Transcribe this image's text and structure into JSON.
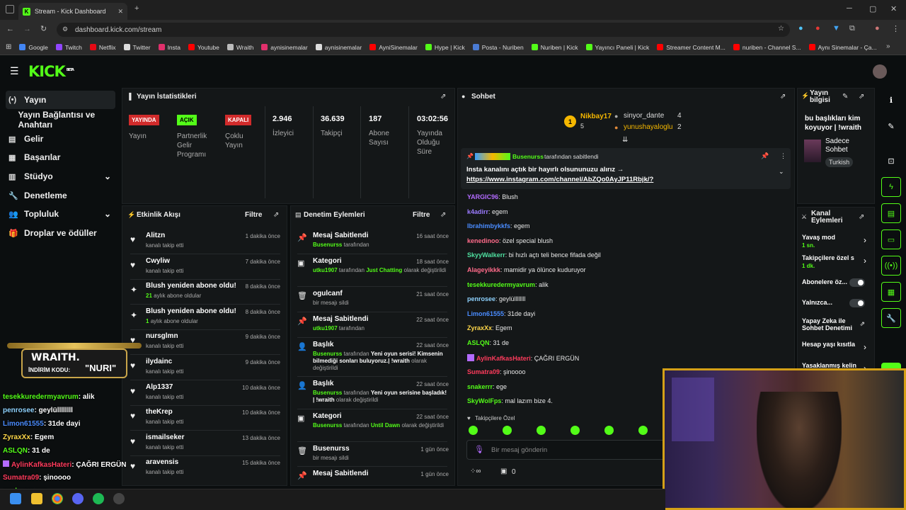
{
  "browser": {
    "tab_title": "Stream - Kick Dashboard",
    "new_tab": "+",
    "url": "dashboard.kick.com/stream",
    "bookmarks": [
      {
        "label": "Google",
        "color": "#4285f4"
      },
      {
        "label": "Twitch",
        "color": "#9146ff"
      },
      {
        "label": "Netflix",
        "color": "#e50914"
      },
      {
        "label": "Twitter",
        "color": "#dddddd"
      },
      {
        "label": "Insta",
        "color": "#e1306c"
      },
      {
        "label": "Youtube",
        "color": "#ff0000"
      },
      {
        "label": "Wraith",
        "color": "#bbbbbb"
      },
      {
        "label": "aynisinemalar",
        "color": "#e1306c"
      },
      {
        "label": "aynisinemalar",
        "color": "#dddddd"
      },
      {
        "label": "AyniSinemalar",
        "color": "#ff0000"
      },
      {
        "label": "Hype | Kick",
        "color": "#53fc18"
      },
      {
        "label": "Posta - Nuriben",
        "color": "#4a7bd4"
      },
      {
        "label": "Nuriben | Kick",
        "color": "#53fc18"
      },
      {
        "label": "Yayıncı Paneli | Kick",
        "color": "#53fc18"
      },
      {
        "label": "Streamer Content M...",
        "color": "#ff0000"
      },
      {
        "label": "nuriben - Channel S...",
        "color": "#ff0000"
      },
      {
        "label": "Aynı Sinemalar - Ça...",
        "color": "#ff0000"
      }
    ],
    "more": "»"
  },
  "app": {
    "logo": "KICK",
    "beta": "BETA"
  },
  "sidebar": [
    {
      "label": "Yayın",
      "icon": "(•)"
    },
    {
      "label": "Yayın Bağlantısı ve Anahtarı",
      "icon": ""
    },
    {
      "label": "Gelir",
      "icon": "▤"
    },
    {
      "label": "Başarılar",
      "icon": "▦"
    },
    {
      "label": "Stüdyo",
      "icon": "▥",
      "chevron": "⌄"
    },
    {
      "label": "Denetleme",
      "icon": "🔧"
    },
    {
      "label": "Topluluk",
      "icon": "👥",
      "chevron": "⌄"
    },
    {
      "label": "Droplar ve ödüller",
      "icon": "🎁"
    }
  ],
  "stats": {
    "title": "Yayın İstatistikleri",
    "live": {
      "badge": "YAYINDA",
      "label": "Yayın"
    },
    "partner": {
      "badge": "AÇIK",
      "label": "Partnerlik Gelir Programı"
    },
    "multi": {
      "badge": "KAPALI",
      "label": "Çoklu Yayın"
    },
    "viewers": {
      "value": "2.946",
      "label": "İzleyici"
    },
    "followers": {
      "value": "36.639",
      "label": "Takipçi"
    },
    "subs": {
      "value": "187",
      "label": "Abone Sayısı"
    },
    "duration": {
      "value": "03:02:56",
      "label": "Yayında Olduğu Süre"
    }
  },
  "activity": {
    "title": "Etkinlik Akışı",
    "filter": "Filtre",
    "items": [
      {
        "icon": "♥",
        "name": "Alitzn",
        "sub": "kanalı takip etti",
        "time": "1 dakika önce"
      },
      {
        "icon": "♥",
        "name": "Cwyliw",
        "sub": "kanalı takip etti",
        "time": "7 dakika önce"
      },
      {
        "icon": "✦",
        "name": "Blush yeniden abone oldu!",
        "subnum": "21",
        "sub": "aylık abone oldular",
        "time": "8 dakika önce"
      },
      {
        "icon": "✦",
        "name": "Blush yeniden abone oldu!",
        "subnum": "1",
        "sub": "aylık abone oldular",
        "time": "8 dakika önce"
      },
      {
        "icon": "♥",
        "name": "nursglmn",
        "sub": "kanalı takip etti",
        "time": "9 dakika önce"
      },
      {
        "icon": "♥",
        "name": "ilydainc",
        "sub": "kanalı takip etti",
        "time": "9 dakika önce"
      },
      {
        "icon": "♥",
        "name": "Alp1337",
        "sub": "kanalı takip etti",
        "time": "10 dakika önce"
      },
      {
        "icon": "♥",
        "name": "theKrep",
        "sub": "kanalı takip etti",
        "time": "10 dakika önce"
      },
      {
        "icon": "♥",
        "name": "ismailseker",
        "sub": "kanalı takip etti",
        "time": "13 dakika önce"
      },
      {
        "icon": "♥",
        "name": "aravensis",
        "sub": "kanalı takip etti",
        "time": "15 dakika önce"
      }
    ]
  },
  "moderation": {
    "title": "Denetim Eylemleri",
    "filter": "Filtre",
    "items": [
      {
        "icon": "📌",
        "title": "Mesaj Sabitlendi",
        "time": "16 saat önce",
        "user": "Busenurss",
        "rest": "tarafından"
      },
      {
        "icon": "▣",
        "title": "Kategori",
        "time": "18 saat önce",
        "user": "utku1907",
        "mid": "tarafından",
        "green2": "Just Chatting",
        "rest": "olarak değiştirildi"
      },
      {
        "icon": "🗑",
        "title": "ogulcanf",
        "time": "21 saat önce",
        "rest": "bir mesajı sildi"
      },
      {
        "icon": "📌",
        "title": "Mesaj Sabitlendi",
        "time": "22 saat önce",
        "user": "utku1907",
        "rest": "tarafından"
      },
      {
        "icon": "👤",
        "title": "Başlık",
        "time": "22 saat önce",
        "user": "Busenurss",
        "mid": "tarafından",
        "white": "Yeni oyun serisi! Kimsenin bilmediği sonları buluyoruz.| !wraith",
        "rest": "olarak değiştirildi"
      },
      {
        "icon": "👤",
        "title": "Başlık",
        "time": "22 saat önce",
        "user": "Busenurss",
        "mid": "tarafından",
        "white": "Yeni oyun serisine başladık! | !wraith",
        "rest": "olarak değiştirildi"
      },
      {
        "icon": "▣",
        "title": "Kategori",
        "time": "22 saat önce",
        "user": "Busenurss",
        "mid": "tarafından",
        "green2": "Until Dawn",
        "rest": "olarak değiştirildi"
      },
      {
        "icon": "🗑",
        "title": "Busenurss",
        "time": "1 gün önce",
        "rest": "bir mesajı sildi"
      },
      {
        "icon": "📌",
        "title": "Mesaj Sabitlendi",
        "time": "1 gün önce"
      }
    ]
  },
  "chat": {
    "title": "Sohbet",
    "top": {
      "rank": "1",
      "user1": "Nikbay17",
      "count1": "5",
      "user2": "sinyor_dante",
      "count2": "4",
      "user3": "yunushayaloglu",
      "count3": "2"
    },
    "pinned": {
      "by": "Busenurss",
      "by_suffix": "tarafından sabitlendi",
      "text": "Insta kanalını açtık bir hayırlı olsununuzu alırız →",
      "link": "https://www.instagram.com/channel/AbZQo0AyJP11Rbjk/?"
    },
    "messages": [
      {
        "user": "YARGIC96",
        "color": "#b36bff",
        "text": ": Blush"
      },
      {
        "user": "k4adirr",
        "color": "#9b7bff",
        "text": ": egem"
      },
      {
        "user": "Ibrahimbykkfs",
        "color": "#4a8cff",
        "text": ": egem"
      },
      {
        "user": "kenedinoo",
        "color": "#ff6b8a",
        "text": ": özel special blush"
      },
      {
        "user": "SkyyWalkerr",
        "color": "#4fe0a0",
        "text": ": bi hızlı açtı teli bence fifada değil"
      },
      {
        "user": "Alageyikkk",
        "color": "#ff6b8a",
        "text": ": mamidir ya ölünce kuduruyor"
      },
      {
        "user": "tesekkuredermyavrum",
        "color": "#53fc18",
        "text": ": alik"
      },
      {
        "user": "penrosee",
        "color": "#8fd3ff",
        "text": ": geylüllllllll"
      },
      {
        "user": "Limon61555",
        "color": "#4a8cff",
        "text": ": 31de dayi"
      },
      {
        "user": "ZyraxXx",
        "color": "#ffd84a",
        "text": ": Egem"
      },
      {
        "user": "ASLQN",
        "color": "#53fc18",
        "text": ": 31 de"
      },
      {
        "user": "AylinKafkasHateri",
        "color": "#ff3b5c",
        "text": ": ÇAĞRI ERGÜN",
        "badge": "#b36bff"
      },
      {
        "user": "Sumatra09",
        "color": "#ff3b5c",
        "text": ": şinoooo"
      },
      {
        "user": "snakerrr",
        "color": "#53fc18",
        "text": ": ege"
      },
      {
        "user": "SkyWolFps",
        "color": "#53fc18",
        "text": ": mal lazım bize 4."
      }
    ],
    "followers_only": "Takipçilere Özel",
    "placeholder": "Bir mesaj gönderin",
    "viewer_count": "0"
  },
  "info": {
    "title": "Yayın bilgisi",
    "text": "bu başlıkları kim koyuyor | !wraith",
    "mode": "Sadece Sohbet",
    "lang": "Turkish"
  },
  "channel": {
    "title": "Kanal Eylemleri",
    "items": [
      {
        "label": "Yavaş mod",
        "sub": "1 sn.",
        "type": "chevron"
      },
      {
        "label": "Takipçilere özel s",
        "sub": "1 dk.",
        "type": "chevron"
      },
      {
        "label": "Abonelere öz...",
        "type": "toggle"
      },
      {
        "label": "Yalnızca...",
        "type": "toggle"
      },
      {
        "label": "Yapay Zeka ile Sohbet Denetimi",
        "type": "link"
      },
      {
        "label": "Hesap yaşı kısıtla",
        "type": "chevron"
      },
      {
        "label": "Yasaklanmış kelin",
        "type": "chevron"
      }
    ]
  },
  "overlay": {
    "brand": "WRAITH.",
    "code_label": "İNDİRİM KODU:",
    "code": "\"NURI\"",
    "lines": [
      {
        "user": "tesekkuredermyavrum",
        "text": ": alik",
        "color": "#53fc18"
      },
      {
        "user": "penrosee",
        "text": ": geylüllllllll",
        "color": "#8fd3ff"
      },
      {
        "user": "Limon61555",
        "text": ": 31de dayi",
        "color": "#4a8cff"
      },
      {
        "user": "ZyraxXx",
        "text": ": Egem",
        "color": "#ffd84a"
      },
      {
        "user": "ASLQN",
        "text": ": 31 de",
        "color": "#53fc18"
      },
      {
        "user": "AylinKafkasHateri",
        "text": ": ÇAĞRI ERGÜN",
        "color": "#ff3b5c"
      },
      {
        "user": "Sumatra09",
        "text": ": şinoooo",
        "color": "#ff3b5c"
      },
      {
        "user": "snakerrr",
        "text": ": ege",
        "color": "#53fc18"
      }
    ]
  },
  "colors": {
    "accent": "#53fc18",
    "live": "#d12b2b",
    "panel": "#141718",
    "bg": "#0b0e0f"
  }
}
